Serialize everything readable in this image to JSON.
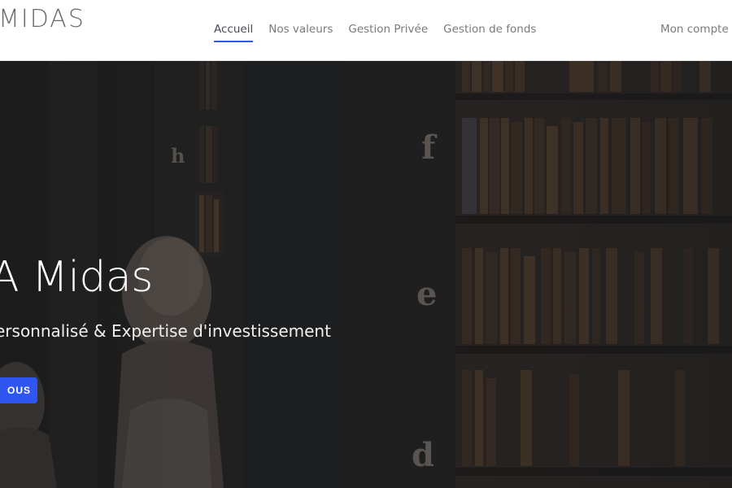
{
  "header": {
    "logo_text": "MIDAS",
    "nav": [
      {
        "label": "Accueil",
        "active": true
      },
      {
        "label": "Nos valeurs",
        "active": false
      },
      {
        "label": "Gestion Privée",
        "active": false
      },
      {
        "label": "Gestion de fonds",
        "active": false
      }
    ],
    "account_label": "Mon compte"
  },
  "hero": {
    "title": "A Midas",
    "subtitle": "ersonnalisé & Expertise d'investissement",
    "button_label": "OUS",
    "background_letters": [
      "h",
      "f",
      "e",
      "d"
    ]
  },
  "colors": {
    "accent": "#2f55f2",
    "nav_active_underline": "#2f5bea",
    "header_bg": "#ffffff",
    "hero_bg": "#232323"
  }
}
